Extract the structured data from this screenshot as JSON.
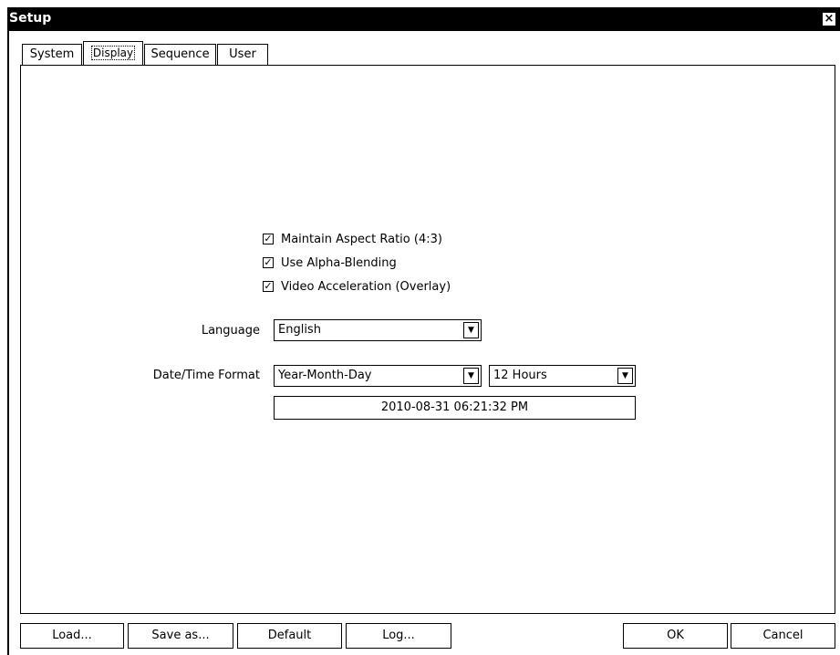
{
  "window": {
    "title": "Setup",
    "close_glyph": "×"
  },
  "tabs": [
    {
      "label": "System"
    },
    {
      "label": "Display",
      "active": true
    },
    {
      "label": "Sequence"
    },
    {
      "label": "User"
    }
  ],
  "display": {
    "options": [
      {
        "label": "Maintain Aspect Ratio (4:3)",
        "checked": true
      },
      {
        "label": "Use Alpha-Blending",
        "checked": true
      },
      {
        "label": "Video Acceleration (Overlay)",
        "checked": true
      }
    ],
    "check_glyph": "✓",
    "language_label": "Language",
    "language_value": "English",
    "datetime_label": "Date/Time Format",
    "date_format_value": "Year-Month-Day",
    "time_format_value": "12 Hours",
    "datetime_preview": "2010-08-31  06:21:32 PM",
    "dropdown_glyph": "▼"
  },
  "buttons": {
    "load": "Load...",
    "save_as": "Save as...",
    "default": "Default",
    "log": "Log...",
    "ok": "OK",
    "cancel": "Cancel"
  }
}
